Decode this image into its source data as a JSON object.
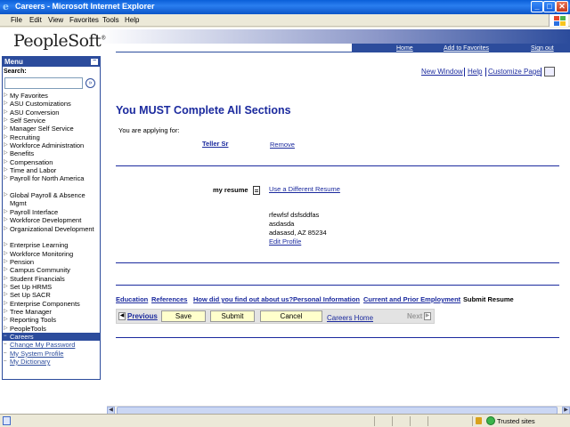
{
  "window": {
    "title": "Careers - Microsoft Internet Explorer",
    "minimize": "_",
    "maximize": "□",
    "close": "✕"
  },
  "menubar": [
    "File",
    "Edit",
    "View",
    "Favorites",
    "Tools",
    "Help"
  ],
  "header": {
    "logo": "PeopleSoft",
    "links": {
      "home": "Home",
      "favorites": "Add to Favorites",
      "signout": "Sign out"
    }
  },
  "menu": {
    "title": "Menu",
    "collapse": "−",
    "search_label": "Search:",
    "search_value": "",
    "go": "»",
    "items": [
      "My Favorites",
      "ASU Customizations",
      "ASU Conversion",
      "Self Service",
      "Manager Self Service",
      "Recruiting",
      "Workforce Administration",
      "Benefits",
      "Compensation",
      "Time and Labor",
      "Payroll for North America",
      "Global Payroll & Absence Mgmt",
      "Payroll Interface",
      "Workforce Development",
      "Organizational Development",
      "Enterprise Learning",
      "Workforce Monitoring",
      "Pension",
      "Campus Community",
      "Student Financials",
      "Set Up HRMS",
      "Set Up SACR",
      "Enterprise Components",
      "Tree Manager",
      "Reporting Tools",
      "PeopleTools"
    ],
    "selected": "Careers",
    "subitems": [
      "Change My Password",
      "My System Profile",
      "My Dictionary"
    ]
  },
  "toolbar": {
    "new_window": "New Window",
    "help": "Help",
    "customize": "Customize Page"
  },
  "main": {
    "title": "You MUST Complete All Sections",
    "applying_label": "You are applying for:",
    "job": "Teller Sr",
    "remove": "Remove",
    "resume_label": "my resume",
    "use_different": "Use a Different Resume",
    "address": [
      "rfewfsf dsfsddfas",
      "asdasda",
      "adasasd, AZ 85234"
    ],
    "edit_profile": "Edit Profile"
  },
  "steps": [
    "Education",
    "References",
    "How did you find out about us?",
    "Personal Information",
    "Current and Prior Employment",
    "Submit Resume"
  ],
  "buttons": {
    "previous": "Previous",
    "save": "Save",
    "submit": "Submit",
    "cancel": "Cancel",
    "careers_home": "Careers Home",
    "next": "Next"
  },
  "status": {
    "zone": "Trusted sites"
  },
  "colors": {
    "accent": "#2c4c9c",
    "link": "#1b2a9e",
    "button": "#ffffcc"
  }
}
